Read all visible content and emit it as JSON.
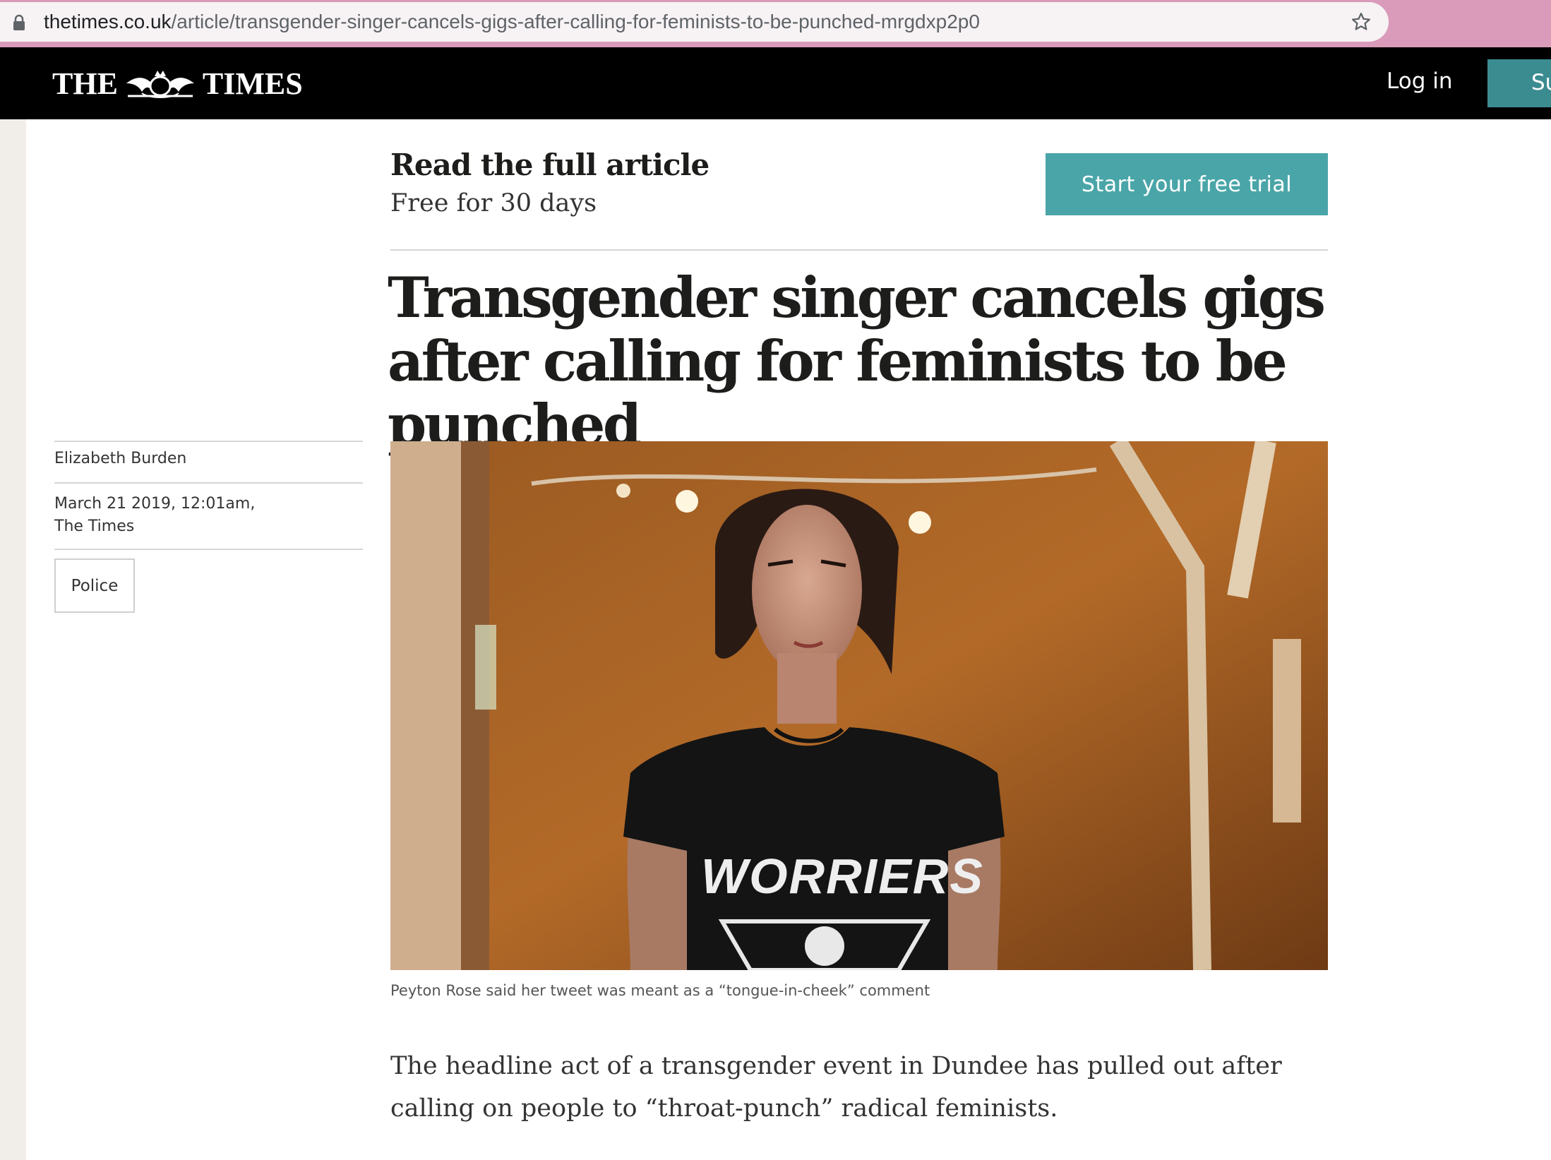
{
  "browser": {
    "url_host": "thetimes.co.uk",
    "url_path": "/article/transgender-singer-cancels-gigs-after-calling-for-feminists-to-be-punched-mrgdxp2p0"
  },
  "masthead": {
    "logo_left": "THE",
    "logo_right": "TIMES",
    "login": "Log in",
    "subscribe": "Su"
  },
  "promo": {
    "title": "Read the full article",
    "subtitle": "Free for 30 days",
    "button": "Start your free trial"
  },
  "article": {
    "headline": "Transgender singer cancels gigs after calling for feminists to be punched",
    "author": "Elizabeth Burden",
    "date": "March 21 2019, 12:01am,",
    "publication": "The Times",
    "tag": "Police",
    "photo_shirt_text": "WORRIERS",
    "caption": "Peyton Rose said her tweet was meant as a “tongue-in-cheek” comment",
    "body": "The headline act of a transgender event in Dundee has pulled out after calling on people to “throat-punch” radical feminists."
  }
}
